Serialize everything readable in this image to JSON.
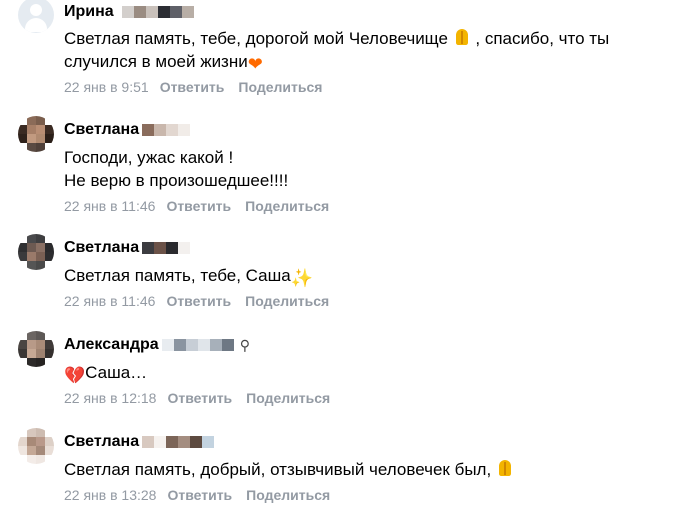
{
  "comments": [
    {
      "author": "Ирина",
      "text_lines": [
        {
          "before": "Светлая память, тебе, дорогой мой Человечище ",
          "emoji": "pray-icon",
          "after": " , спасибо, что ты"
        },
        {
          "before": "случился в моей жизни",
          "emoji": "orange-heart-icon",
          "after": ""
        }
      ],
      "time": "22 янв в 9:51",
      "reply": "Ответить",
      "share": "Поделиться"
    },
    {
      "author": "Светлана",
      "text_lines": [
        {
          "before": "Господи, ужас какой !",
          "emoji": "",
          "after": ""
        },
        {
          "before": "Не верю в произошедшее!!!!",
          "emoji": "",
          "after": ""
        }
      ],
      "time": "22 янв в 11:46",
      "reply": "Ответить",
      "share": "Поделиться"
    },
    {
      "author": "Светлана",
      "text_lines": [
        {
          "before": "Светлая память, тебе, Саша",
          "emoji": "sparkles-icon",
          "after": ""
        }
      ],
      "time": "22 янв в 11:46",
      "reply": "Ответить",
      "share": "Поделиться"
    },
    {
      "author": "Александра",
      "text_lines": [
        {
          "before": "",
          "emoji": "broken-heart-icon",
          "after": "Саша…"
        }
      ],
      "time": "22 янв в 12:18",
      "reply": "Ответить",
      "share": "Поделиться"
    },
    {
      "author": "Светлана",
      "text_lines": [
        {
          "before": "Светлая память, добрый, отзывчивый человечек был, ",
          "emoji": "pray-icon",
          "after": ""
        }
      ],
      "time": "22 янв в 13:28",
      "reply": "Ответить",
      "share": "Поделиться"
    }
  ],
  "colors": {
    "meta": "#939aa3",
    "default_avatar": "#e5ebf1"
  }
}
